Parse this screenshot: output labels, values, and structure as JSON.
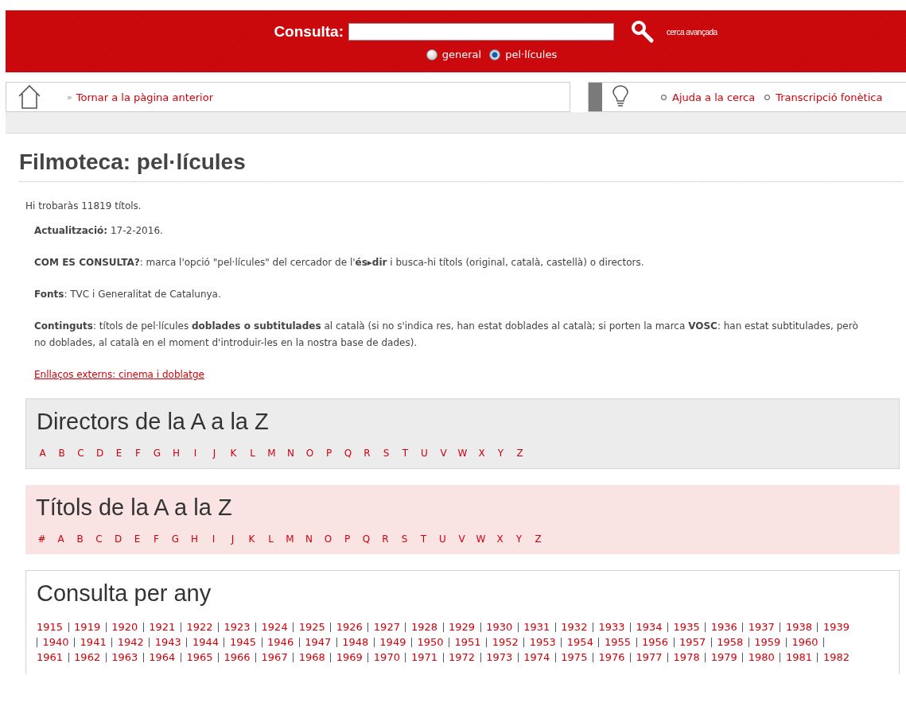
{
  "search": {
    "label": "Consulta:",
    "advanced_link": "cerca avançada",
    "scopes": [
      {
        "label": "general",
        "selected": false
      },
      {
        "label": "pel·lícules",
        "selected": true
      }
    ]
  },
  "nav": {
    "back_mark": "»",
    "back_link": "Tornar a la pàgina anterior",
    "help_links": [
      "Ajuda a la cerca",
      "Transcripció fonètica"
    ]
  },
  "page": {
    "title": "Filmoteca: pel·lícules",
    "paragraphs": [
      {
        "kind": "plain",
        "text": "Hi trobaràs 11819 títols."
      },
      {
        "kind": "indented",
        "text": "**Actualització:** 17-2-2016."
      },
      {
        "kind": "indented",
        "text": "**COM ES CONSULTA?**: marca l'opció \"pel·lícules\" del cercador de l'**és▸dir** i busca-hi títols (original, català, castellà) o directors."
      },
      {
        "kind": "indented",
        "text": "**Fonts**: TVC i Generalitat de Catalunya."
      },
      {
        "kind": "indented",
        "text": "**Continguts**: títols de pel·lícules **doblades o subtitulades** al català (si no s'indica res, han estat doblades al català; si porten la marca **VOSC**: han estat subtitulades, però no doblades, al català en el moment d'introduir-les en la nostra base de dades)."
      },
      {
        "kind": "link",
        "text": "Enllaços externs: cinema i doblatge"
      }
    ]
  },
  "sections": [
    {
      "kind": "directors",
      "title": "Directors de la A a la Z",
      "links": [
        "A",
        "B",
        "C",
        "D",
        "E",
        "F",
        "G",
        "H",
        "I",
        "J",
        "K",
        "L",
        "M",
        "N",
        "O",
        "P",
        "Q",
        "R",
        "S",
        "T",
        "U",
        "V",
        "W",
        "X",
        "Y",
        "Z"
      ]
    },
    {
      "kind": "titles",
      "title": "Títols de la A a la Z",
      "links": [
        "#",
        "A",
        "B",
        "C",
        "D",
        "E",
        "F",
        "G",
        "H",
        "I",
        "J",
        "K",
        "L",
        "M",
        "N",
        "O",
        "P",
        "Q",
        "R",
        "S",
        "T",
        "U",
        "V",
        "W",
        "X",
        "Y",
        "Z"
      ]
    },
    {
      "kind": "years",
      "title": "Consulta per any",
      "rows": [
        [
          "1915",
          "1919",
          "1920",
          "1921",
          "1922",
          "1923",
          "1924",
          "1925",
          "1926",
          "1927",
          "1928",
          "1929",
          "1930",
          "1931",
          "1932",
          "1933",
          "1934",
          "1935",
          "1936",
          "1937",
          "1938",
          "1939"
        ],
        [
          "1940",
          "1941",
          "1942",
          "1943",
          "1944",
          "1945",
          "1946",
          "1947",
          "1948",
          "1949",
          "1950",
          "1951",
          "1952",
          "1953",
          "1954",
          "1955",
          "1956",
          "1957",
          "1958",
          "1959",
          "1960"
        ],
        [
          "1961",
          "1962",
          "1963",
          "1964",
          "1965",
          "1966",
          "1967",
          "1968",
          "1969",
          "1970",
          "1971",
          "1972",
          "1973",
          "1974",
          "1975",
          "1976",
          "1977",
          "1978",
          "1979",
          "1980",
          "1981",
          "1982"
        ]
      ]
    }
  ]
}
